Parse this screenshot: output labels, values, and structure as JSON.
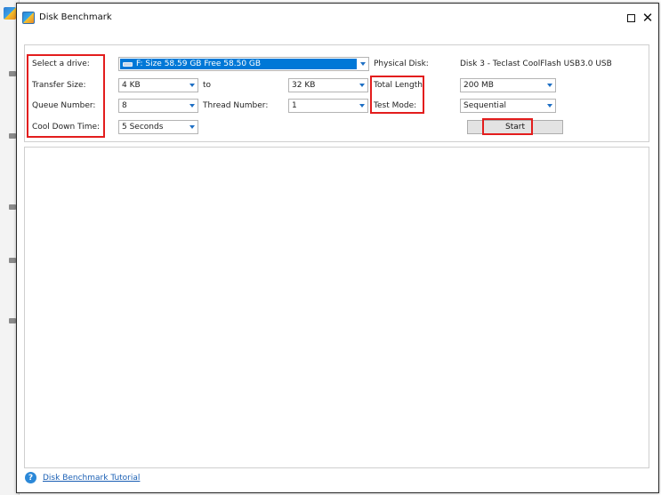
{
  "window": {
    "title": "Disk Benchmark"
  },
  "settings": {
    "select_drive_label": "Select a drive:",
    "drive_value": "F:  Size 58.59 GB  Free 58.50 GB",
    "physical_disk_label": "Physical Disk:",
    "physical_disk_value": "Disk 3 - Teclast CoolFlash USB3.0 USB",
    "transfer_size_label": "Transfer Size:",
    "transfer_size_from": "4 KB",
    "to_label": "to",
    "transfer_size_to": "32 KB",
    "total_length_label": "Total Length:",
    "total_length_value": "200 MB",
    "queue_number_label": "Queue Number:",
    "queue_number_value": "8",
    "thread_number_label": "Thread Number:",
    "thread_number_value": "1",
    "test_mode_label": "Test Mode:",
    "test_mode_value": "Sequential",
    "cool_down_label": "Cool Down Time:",
    "cool_down_value": "5 Seconds",
    "start_label": "Start"
  },
  "footer": {
    "help_icon": "?",
    "tutorial_link": "Disk Benchmark Tutorial"
  },
  "colors": {
    "highlight_box": "#e31d1d",
    "selection": "#0078d7",
    "link": "#1a5fb4"
  }
}
